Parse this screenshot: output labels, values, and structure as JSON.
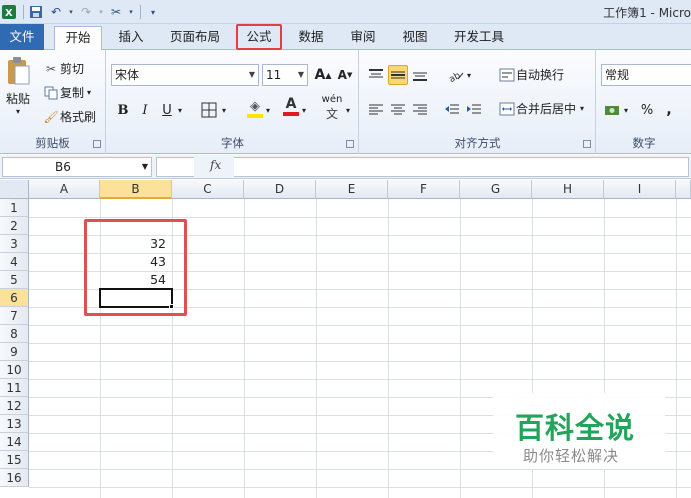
{
  "window": {
    "title": "工作簿1 - Micro"
  },
  "tabs": [
    {
      "label": "文件"
    },
    {
      "label": "开始"
    },
    {
      "label": "插入"
    },
    {
      "label": "页面布局"
    },
    {
      "label": "公式"
    },
    {
      "label": "数据"
    },
    {
      "label": "审阅"
    },
    {
      "label": "视图"
    },
    {
      "label": "开发工具"
    }
  ],
  "ribbon": {
    "clipboard": {
      "label": "剪贴板",
      "paste": "粘贴",
      "cut": "剪切",
      "copy": "复制",
      "format_painter": "格式刷"
    },
    "font": {
      "label": "字体",
      "font_name": "宋体",
      "font_size": "11",
      "bold": "B",
      "italic": "I",
      "underline": "U",
      "grow": "A",
      "shrink": "A",
      "wen": "wén"
    },
    "alignment": {
      "label": "对齐方式",
      "wrap_text": "自动换行",
      "merge_center": "合并后居中"
    },
    "number": {
      "label": "数字",
      "format": "常规",
      "percent": "%",
      "comma": ","
    }
  },
  "formula_bar": {
    "name_box": "B6",
    "fx": "fx",
    "content": ""
  },
  "sheet": {
    "columns": [
      "A",
      "B",
      "C",
      "D",
      "E",
      "F",
      "G",
      "H",
      "I"
    ],
    "rows": [
      "1",
      "2",
      "3",
      "4",
      "5",
      "6",
      "7",
      "8",
      "9",
      "10",
      "11",
      "12",
      "13",
      "14",
      "15",
      "16"
    ],
    "cells": {
      "B3": "32",
      "B4": "43",
      "B5": "54"
    },
    "selected_cell": "B6"
  },
  "watermark": {
    "title": "百科全说",
    "subtitle": "助你轻松解决"
  },
  "colors": {
    "file_tab": "#2f6bb3",
    "highlight": "#e0413c",
    "watermark_green": "#22a55a"
  }
}
